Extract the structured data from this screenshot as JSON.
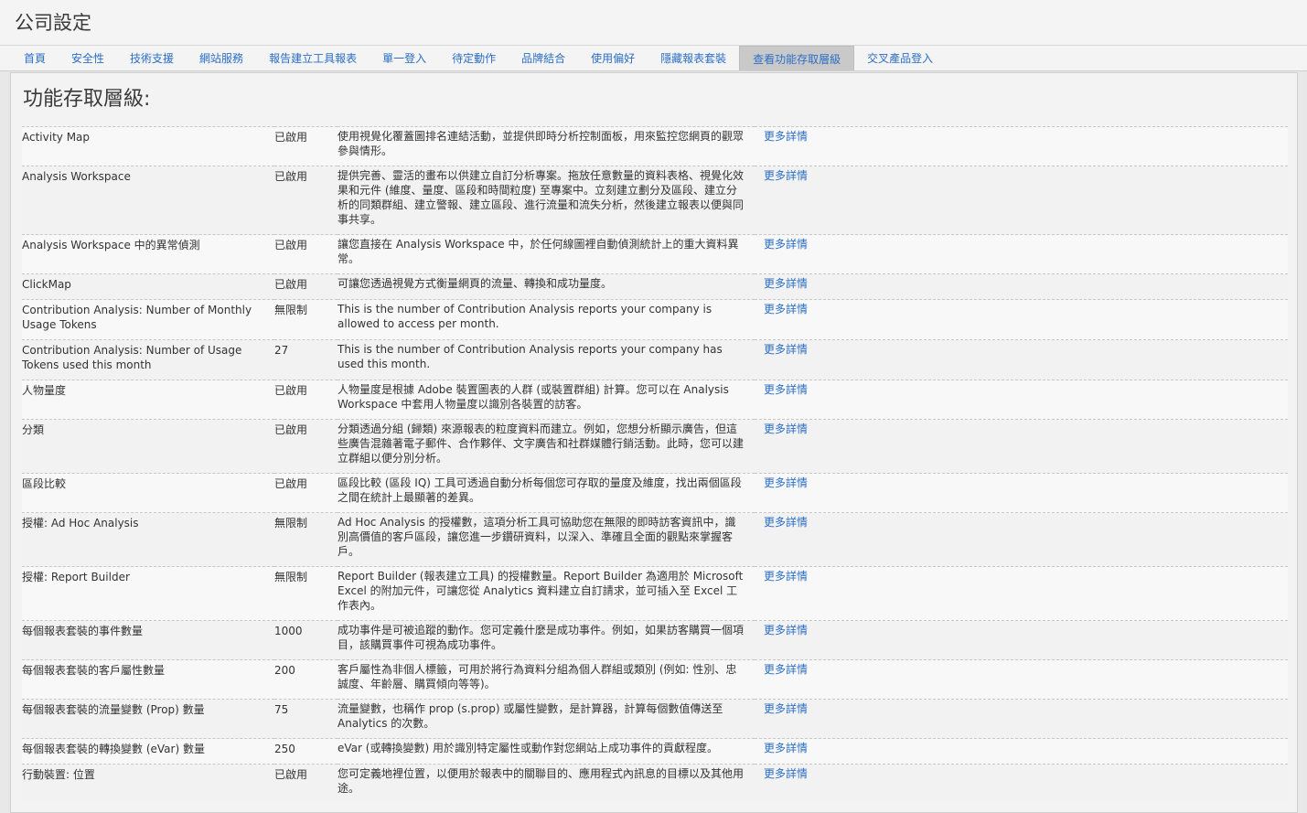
{
  "header": {
    "title": "公司設定"
  },
  "tabs": [
    {
      "label": "首頁"
    },
    {
      "label": "安全性"
    },
    {
      "label": "技術支援"
    },
    {
      "label": "網站服務"
    },
    {
      "label": "報告建立工具報表"
    },
    {
      "label": "單一登入"
    },
    {
      "label": "待定動作"
    },
    {
      "label": "品牌結合"
    },
    {
      "label": "使用偏好"
    },
    {
      "label": "隱藏報表套裝"
    },
    {
      "label": "查看功能存取層級",
      "active": true
    },
    {
      "label": "交叉產品登入"
    }
  ],
  "panel": {
    "heading": "功能存取層級:"
  },
  "more_label": "更多詳情",
  "rows": [
    {
      "name": "Activity Map",
      "status": "已啟用",
      "desc": "使用視覺化覆蓋圖排名連結活動，並提供即時分析控制面板，用來監控您網頁的觀眾參與情形。"
    },
    {
      "name": "Analysis Workspace",
      "status": "已啟用",
      "desc": "提供完善、靈活的畫布以供建立自訂分析專案。拖放任意數量的資料表格、視覺化效果和元件 (維度、量度、區段和時間粒度) 至專案中。立刻建立劃分及區段、建立分析的同類群組、建立警報、建立區段、進行流量和流失分析，然後建立報表以便與同事共享。"
    },
    {
      "name": "Analysis Workspace 中的異常偵測",
      "status": "已啟用",
      "desc": "讓您直接在 Analysis Workspace 中，於任何線圖裡自動偵測統計上的重大資料異常。"
    },
    {
      "name": "ClickMap",
      "status": "已啟用",
      "desc": "可讓您透過視覺方式衡量網頁的流量、轉換和成功量度。"
    },
    {
      "name": "Contribution Analysis: Number of Monthly Usage Tokens",
      "status": "無限制",
      "desc": "This is the number of Contribution Analysis reports your company is allowed to access per month."
    },
    {
      "name": "Contribution Analysis: Number of Usage Tokens used this month",
      "status": "27",
      "desc": "This is the number of Contribution Analysis reports your company has used this month."
    },
    {
      "name": "人物量度",
      "status": "已啟用",
      "desc": "人物量度是根據 Adobe 裝置圖表的人群 (或裝置群組) 計算。您可以在 Analysis Workspace 中套用人物量度以識別各裝置的訪客。"
    },
    {
      "name": "分類",
      "status": "已啟用",
      "desc": "分類透過分組 (歸類) 來源報表的粒度資料而建立。例如，您想分析顯示廣告，但這些廣告混雜著電子郵件、合作夥伴、文字廣告和社群媒體行銷活動。此時，您可以建立群組以便分別分析。"
    },
    {
      "name": "區段比較",
      "status": "已啟用",
      "desc": "區段比較 (區段 IQ) 工具可透過自動分析每個您可存取的量度及維度，找出兩個區段之間在統計上最顯著的差異。"
    },
    {
      "name": "授權: Ad Hoc Analysis",
      "status": "無限制",
      "desc": "Ad Hoc Analysis 的授權數，這項分析工具可協助您在無限的即時訪客資訊中，識別高價值的客戶區段，讓您進一步鑽研資料，以深入、準確且全面的觀點來掌握客戶。"
    },
    {
      "name": "授權: Report Builder",
      "status": "無限制",
      "desc": "Report Builder (報表建立工具) 的授權數量。Report Builder 為適用於 Microsoft Excel 的附加元件，可讓您從 Analytics 資料建立自訂請求，並可插入至 Excel 工作表內。"
    },
    {
      "name": "每個報表套裝的事件數量",
      "status": "1000",
      "desc": "成功事件是可被追蹤的動作。您可定義什麼是成功事件。例如，如果訪客購買一個項目，該購買事件可視為成功事件。"
    },
    {
      "name": "每個報表套裝的客戶屬性數量",
      "status": "200",
      "desc": "客戶屬性為非個人標籤，可用於將行為資料分組為個人群組或類別 (例如: 性別、忠誠度、年齡層、購買傾向等等)。"
    },
    {
      "name": "每個報表套裝的流量變數 (Prop) 數量",
      "status": "75",
      "desc": "流量變數，也稱作 prop (s.prop) 或屬性變數，是計算器，計算每個數值傳送至 Analytics 的次數。"
    },
    {
      "name": "每個報表套裝的轉換變數 (eVar) 數量",
      "status": "250",
      "desc": "eVar (或轉換變數) 用於識別特定屬性或動作對您網站上成功事件的貢獻程度。"
    },
    {
      "name": "行動裝置: 位置",
      "status": "已啟用",
      "desc": "您可定義地裡位置，以便用於報表中的關聯目的、應用程式內訊息的目標以及其他用途。"
    }
  ]
}
